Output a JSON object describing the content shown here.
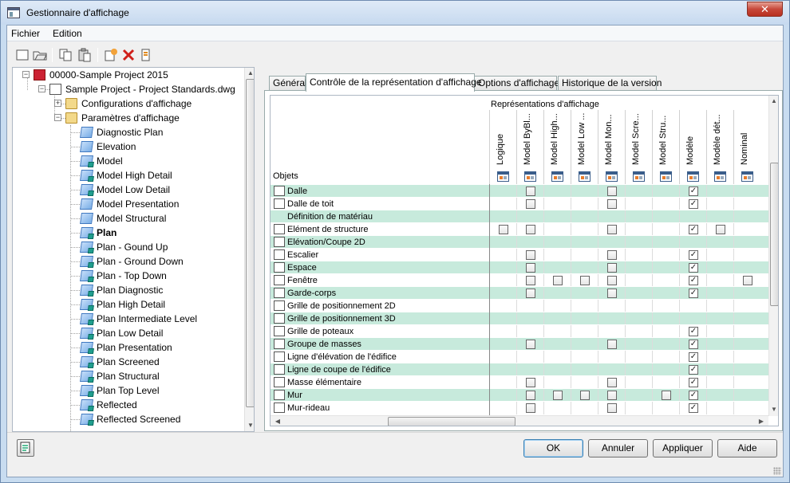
{
  "window": {
    "title": "Gestionnaire d'affichage",
    "close_label": "✕"
  },
  "menu": {
    "file": "Fichier",
    "edit": "Edition"
  },
  "toolbar": {
    "icons": [
      "new-icon",
      "open-icon",
      "copy-icon",
      "paste-icon",
      "new-representation-icon",
      "delete-icon",
      "purge-icon"
    ]
  },
  "tree": {
    "root": "00000-Sample Project 2015",
    "drawing": "Sample Project - Project Standards.dwg",
    "configs": "Configurations d'affichage",
    "params": "Paramètres d'affichage",
    "items": [
      "Diagnostic Plan",
      "Elevation",
      "Model",
      "Model High Detail",
      "Model Low Detail",
      "Model Presentation",
      "Model Structural",
      "Plan",
      "Plan - Gound Up",
      "Plan - Ground Down",
      "Plan - Top Down",
      "Plan Diagnostic",
      "Plan High Detail",
      "Plan Intermediate Level",
      "Plan Low Detail",
      "Plan Presentation",
      "Plan Screened",
      "Plan Structural",
      "Plan Top Level",
      "Reflected",
      "Reflected Screened"
    ],
    "selected": "Plan",
    "checked": [
      "Model",
      "Model High Detail",
      "Model Low Detail",
      "Plan",
      "Plan - Gound Up",
      "Plan - Ground Down",
      "Plan - Top Down",
      "Plan Diagnostic",
      "Plan High Detail",
      "Plan Intermediate Level",
      "Plan Low Detail",
      "Plan Presentation",
      "Plan Screened",
      "Plan Structural",
      "Plan Top Level",
      "Reflected",
      "Reflected Screened"
    ]
  },
  "tabs": [
    "Général",
    "Contrôle de la représentation d'affichage",
    "Options d'affichage",
    "Historique de la version"
  ],
  "active_tab": 1,
  "grid": {
    "header_title": "Représentations d'affichage",
    "objects_label": "Objets",
    "columns": [
      "Logique",
      "Model ByBl...",
      "Model High...",
      "Model Low ...",
      "Model Mon...",
      "Model Scre...",
      "Model Stru...",
      "Modèle",
      "Modèle dét...",
      "Nominal"
    ],
    "rows": [
      {
        "name": "Dalle",
        "icon": "slab-icon",
        "cells": [
          "",
          "off",
          "",
          "",
          "off",
          "",
          "",
          "on",
          "",
          ""
        ]
      },
      {
        "name": "Dalle de toit",
        "icon": "roof-slab-icon",
        "cells": [
          "",
          "off",
          "",
          "",
          "off",
          "",
          "",
          "on",
          "",
          ""
        ]
      },
      {
        "name": "Définition de matériau",
        "icon": "",
        "cells": [
          "",
          "",
          "",
          "",
          "",
          "",
          "",
          "",
          "",
          ""
        ]
      },
      {
        "name": "Elément de structure",
        "icon": "structural-member-icon",
        "cells": [
          "off",
          "off",
          "",
          "",
          "off",
          "",
          "",
          "on",
          "off",
          ""
        ]
      },
      {
        "name": "Elévation/Coupe 2D",
        "icon": "section-elevation-icon",
        "cells": [
          "",
          "",
          "",
          "",
          "",
          "",
          "",
          "",
          "",
          ""
        ]
      },
      {
        "name": "Escalier",
        "icon": "stair-icon",
        "cells": [
          "",
          "off",
          "",
          "",
          "off",
          "",
          "",
          "on",
          "",
          ""
        ]
      },
      {
        "name": "Espace",
        "icon": "space-icon",
        "cells": [
          "",
          "off",
          "",
          "",
          "off",
          "",
          "",
          "on",
          "",
          ""
        ]
      },
      {
        "name": "Fenêtre",
        "icon": "window-icon",
        "cells": [
          "",
          "off",
          "off",
          "off",
          "off",
          "",
          "",
          "on",
          "",
          "off"
        ]
      },
      {
        "name": "Garde-corps",
        "icon": "railing-icon",
        "cells": [
          "",
          "off",
          "",
          "",
          "off",
          "",
          "",
          "on",
          "",
          ""
        ]
      },
      {
        "name": "Grille de positionnement 2D",
        "icon": "layout-grid-2d-icon",
        "cells": [
          "",
          "",
          "",
          "",
          "",
          "",
          "",
          "",
          "",
          ""
        ]
      },
      {
        "name": "Grille de positionnement 3D",
        "icon": "layout-grid-3d-icon",
        "cells": [
          "",
          "",
          "",
          "",
          "",
          "",
          "",
          "",
          "",
          ""
        ]
      },
      {
        "name": "Grille de poteaux",
        "icon": "column-grid-icon",
        "cells": [
          "",
          "",
          "",
          "",
          "",
          "",
          "",
          "on",
          "",
          ""
        ]
      },
      {
        "name": "Groupe de masses",
        "icon": "mass-group-icon",
        "cells": [
          "",
          "off",
          "",
          "",
          "off",
          "",
          "",
          "on",
          "",
          ""
        ]
      },
      {
        "name": "Ligne d'élévation de l'édifice",
        "icon": "elevation-line-icon",
        "cells": [
          "",
          "",
          "",
          "",
          "",
          "",
          "",
          "on",
          "",
          ""
        ]
      },
      {
        "name": "Ligne de coupe de l'édifice",
        "icon": "section-line-icon",
        "cells": [
          "",
          "",
          "",
          "",
          "",
          "",
          "",
          "on",
          "",
          ""
        ]
      },
      {
        "name": "Masse élémentaire",
        "icon": "mass-element-icon",
        "cells": [
          "",
          "off",
          "",
          "",
          "off",
          "",
          "",
          "on",
          "",
          ""
        ]
      },
      {
        "name": "Mur",
        "icon": "wall-icon",
        "cells": [
          "",
          "off",
          "off",
          "off",
          "off",
          "",
          "off",
          "on",
          "",
          ""
        ]
      },
      {
        "name": "Mur-rideau",
        "icon": "curtain-wall-icon",
        "cells": [
          "",
          "off",
          "",
          "",
          "off",
          "",
          "",
          "on",
          "",
          ""
        ]
      }
    ]
  },
  "buttons": {
    "ok": "OK",
    "cancel": "Annuler",
    "apply": "Appliquer",
    "help": "Aide"
  }
}
